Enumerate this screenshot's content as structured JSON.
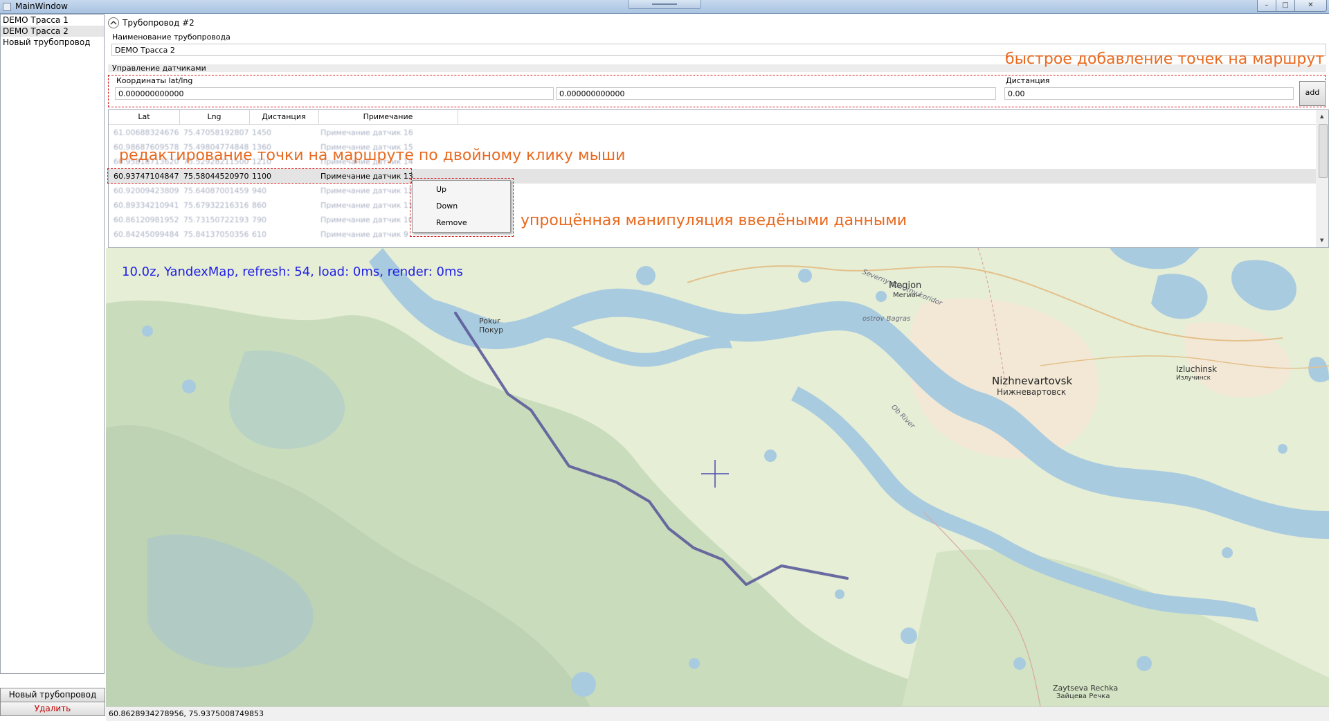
{
  "window": {
    "title": "MainWindow",
    "controls": [
      "–",
      "□",
      "✕"
    ]
  },
  "left_panel": {
    "items": [
      {
        "label": "DEMO Трасса 1"
      },
      {
        "label": "DEMO Трасса 2"
      },
      {
        "label": "Новый трубопровод"
      }
    ],
    "new_button": "Новый трубопровод",
    "delete_button": "Удалить"
  },
  "pipeline": {
    "header": "Трубопровод #2",
    "name_label": "Наименование трубопровода",
    "name_value": "DEMO Трасса 2",
    "sensors_label": "Управление датчиками",
    "coords_label": "Координаты lat/lng",
    "lat_value": "0.000000000000",
    "lng_value": "0.000000000000",
    "distance_label": "Дистанция",
    "distance_value": "0.00",
    "add_label": "add"
  },
  "grid": {
    "columns": [
      "Lat",
      "Lng",
      "Дистанция",
      "Примечание"
    ],
    "rows": [
      {
        "lat": "61.00688324676",
        "lng": "75.47058192807",
        "dist": "1450",
        "note": "Примечание датчик 16"
      },
      {
        "lat": "60.98687609578",
        "lng": "75.49804774848",
        "dist": "1360",
        "note": "Примечание датчик 15"
      },
      {
        "lat": "60.95818713620",
        "lng": "75.52928211500",
        "dist": "1210",
        "note": "Примечание датчик 14"
      },
      {
        "lat": "60.93747104847",
        "lng": "75.58044520970",
        "dist": "1100",
        "note": "Примечание датчик 13"
      },
      {
        "lat": "60.92009423809",
        "lng": "75.64087001459",
        "dist": "940",
        "note": "Примечание датчик 12"
      },
      {
        "lat": "60.89334210941",
        "lng": "75.67932216316",
        "dist": "860",
        "note": "Примечание датчик 11"
      },
      {
        "lat": "60.86120981952",
        "lng": "75.73150722193",
        "dist": "790",
        "note": "Примечание датчик 10"
      },
      {
        "lat": "60.84245099484",
        "lng": "75.84137050356",
        "dist": "610",
        "note": "Примечание датчик 9"
      }
    ]
  },
  "context_menu": {
    "items": [
      "Up",
      "Down",
      "Remove"
    ]
  },
  "annotations": {
    "quick_add": "быстрое добавление точек на маршрут",
    "edit": "редактирование точки на маршруте по двойному клику мыши",
    "manipulate": "упрощённая манипуляция введёными данными"
  },
  "map": {
    "status": "10.0z, YandexMap, refresh: 54, load: 0ms, render: 0ms",
    "labels": {
      "megion": "Megion",
      "megion_ru": "Мегион",
      "pokur": "Pokur",
      "pokur_ru": "Покур",
      "nizhnevartovsk": "Nizhnevartovsk",
      "nizhnevartovsk_ru": "Нижневартовск",
      "izluchinsk": "Izluchinsk",
      "izluchinsk_ru": "Излучинск",
      "ostrov": "ostrov Bagras",
      "severny": "Severny shirotny koridor",
      "ob_river": "Ob River",
      "zaytseva": "Zaytseva Rechka",
      "zaytseva_ru": "Зайцева Речка"
    },
    "colors": {
      "water": "#a9cbe0",
      "forest": "#c9dcbc",
      "route": "#5b5b9a",
      "urban": "#f2e8d5"
    }
  },
  "status_bar": {
    "coords": "60.8628934278956, 75.9375008749853"
  }
}
